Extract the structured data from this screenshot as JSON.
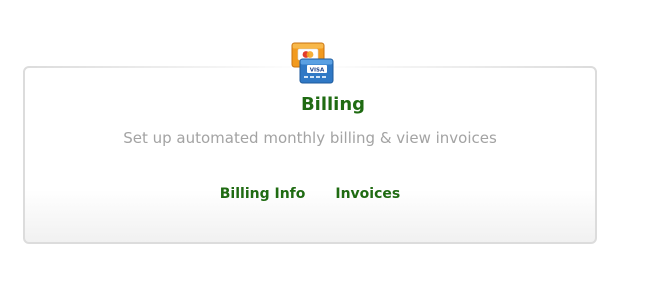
{
  "billing_card": {
    "icon": "credit-cards-icon",
    "title": "Billing",
    "description": "Set up automated monthly billing & view invoices",
    "links": [
      {
        "label": "Billing Info"
      },
      {
        "label": "Invoices"
      }
    ]
  },
  "colors": {
    "accent_green": "#1f6b12",
    "muted_text": "#a3a3a3",
    "card_border": "#dcdcdc"
  }
}
